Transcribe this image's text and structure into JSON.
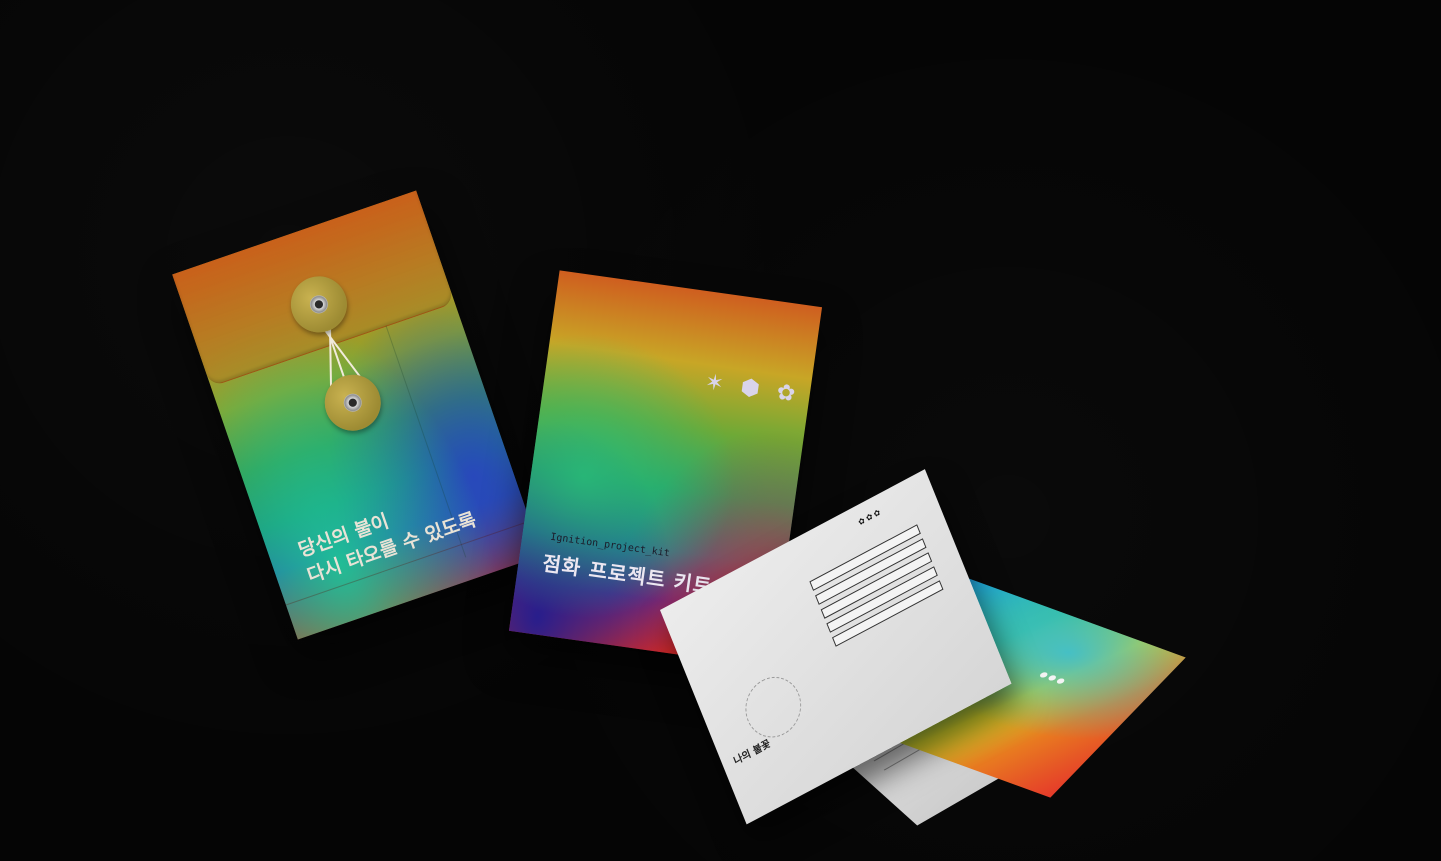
{
  "envelope": {
    "line1": "당신의 불이",
    "line2": "다시 타오를 수 있도록"
  },
  "card": {
    "subtitle": "Ignition_project_kit",
    "title": "점화 프로젝트 키트"
  },
  "leaflet": {
    "title": "나의 불꽃"
  },
  "colors": {
    "background": "#050505",
    "text_light": "#e9e3d6"
  }
}
